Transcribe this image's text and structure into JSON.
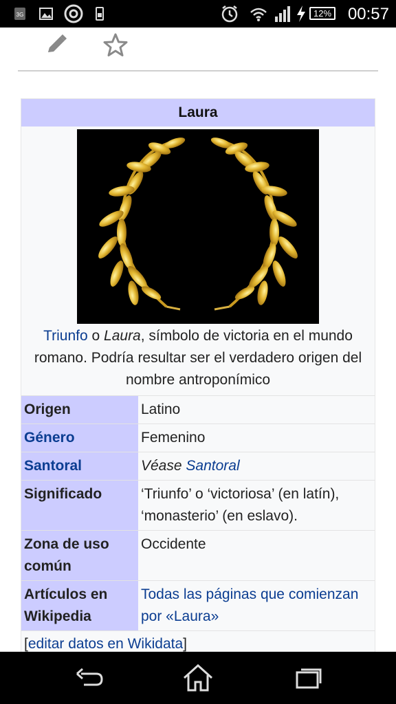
{
  "status_bar": {
    "time": "00:57",
    "battery": "12%",
    "icons": [
      "sim-3g-icon",
      "image-icon",
      "circle-a-icon",
      "device-icon",
      "alarm-icon",
      "wifi-icon",
      "signal-icon",
      "charging-icon",
      "battery-icon"
    ]
  },
  "toolbar": {
    "edit_icon": "pencil-icon",
    "star_icon": "star-icon"
  },
  "infobox": {
    "title": "Laura",
    "caption": {
      "link": "Triunfo",
      "text1": " o ",
      "italic": "Laura",
      "text2": ", símbolo de victoria en el mundo romano. Podría resultar ser el verdadero origen del nombre antroponímico"
    },
    "rows": [
      {
        "key": "Origen",
        "value": "Latino"
      },
      {
        "key": "Género",
        "value": "Femenino"
      },
      {
        "key": "Santoral",
        "value_prefix": "Véase ",
        "value_link": "Santoral"
      },
      {
        "key": "Significado",
        "value": "‘Triunfo’ o ‘victoriosa’ (en latín), ‘monasterio’ (en eslavo)."
      },
      {
        "key": "Zona de uso común",
        "value": "Occidente"
      },
      {
        "key": "Artículos en Wikipedia",
        "value_link": "Todas las páginas que comienzan por «Laura»"
      }
    ],
    "footer": {
      "open": "[",
      "link": "editar datos en Wikidata",
      "close": "]"
    }
  },
  "nav_bar": {
    "back": "back-icon",
    "home": "home-icon",
    "recents": "recents-icon"
  },
  "colors": {
    "header_bg": "#ccccff",
    "link": "#0b3d91",
    "box_bg": "#f8f9fa"
  }
}
